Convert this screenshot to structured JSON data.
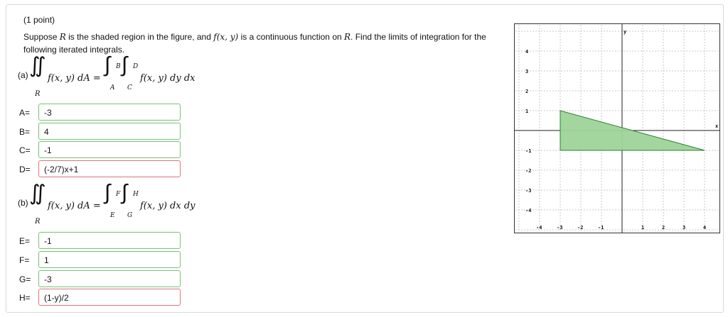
{
  "header": {
    "points": "(1 point)"
  },
  "prompt": {
    "text_start": "Suppose ",
    "R": "R",
    "text_mid": " is the shaded region in the figure, and ",
    "fxy": "f(x, y)",
    "text_mid2": " is a continuous function on ",
    "R2": "R",
    "text_end": ". Find the limits of integration for the following iterated integrals."
  },
  "part_a": {
    "label": "(a)",
    "lhs": "f(x, y) dA =",
    "region": "R",
    "integrand": "f(x, y) dy dx",
    "outer_upper": "B",
    "outer_lower": "A",
    "inner_upper": "D",
    "inner_lower": "C",
    "fields": [
      {
        "label": "A=",
        "value": "-3",
        "status": "correct"
      },
      {
        "label": "B=",
        "value": "4",
        "status": "correct"
      },
      {
        "label": "C=",
        "value": "-1",
        "status": "correct"
      },
      {
        "label": "D=",
        "value": "(-2/7)x+1",
        "status": "incorrect"
      }
    ]
  },
  "part_b": {
    "label": "(b)",
    "lhs": "f(x, y) dA =",
    "region": "R",
    "integrand": "f(x, y) dx dy",
    "outer_upper": "F",
    "outer_lower": "E",
    "inner_upper": "H",
    "inner_lower": "G",
    "fields": [
      {
        "label": "E=",
        "value": "-1",
        "status": "correct"
      },
      {
        "label": "F=",
        "value": "1",
        "status": "correct"
      },
      {
        "label": "G=",
        "value": "-3",
        "status": "correct"
      },
      {
        "label": "H=",
        "value": "(1-y)/2",
        "status": "incorrect"
      }
    ]
  },
  "graph": {
    "x_axis_label": "x",
    "y_axis_label": "y",
    "x_ticks": [
      "-4",
      "-3",
      "-2",
      "-1",
      "1",
      "2",
      "3",
      "4"
    ],
    "y_ticks": [
      "4",
      "3",
      "2",
      "1",
      "-1",
      "-2",
      "-3",
      "-4"
    ],
    "region_vertices": [
      [
        -3,
        1
      ],
      [
        -3,
        -1
      ],
      [
        4,
        -1
      ]
    ],
    "fill_color": "#9ed49a",
    "stroke_color": "#2e7d32"
  }
}
